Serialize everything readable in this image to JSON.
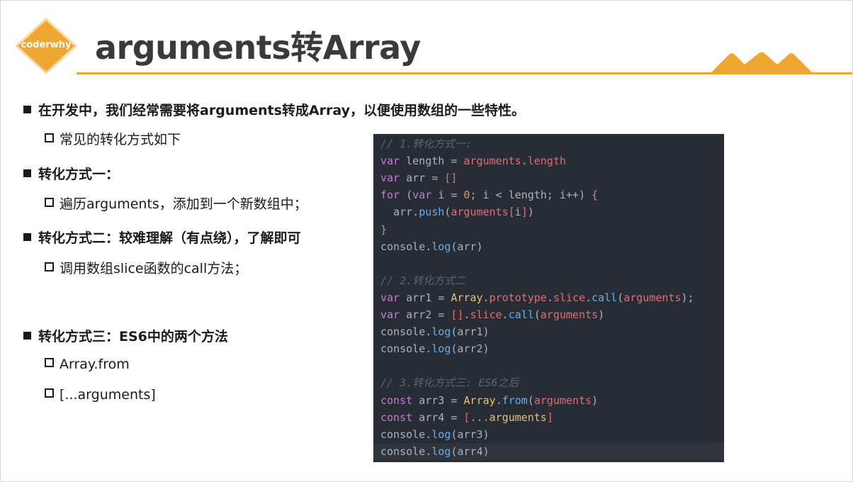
{
  "header": {
    "logo_text": "coderwhy",
    "title": "arguments转Array"
  },
  "colors": {
    "accent": "#f0a732",
    "code_bg": "#282c34"
  },
  "bullets": [
    {
      "level": 1,
      "text": "在开发中，我们经常需要将arguments转成Array，以便使用数组的一些特性。"
    },
    {
      "level": 2,
      "text": "常见的转化方式如下"
    },
    {
      "level": 1,
      "text": "转化方式一："
    },
    {
      "level": 2,
      "text": "遍历arguments，添加到一个新数组中；"
    },
    {
      "level": 1,
      "text": "转化方式二：较难理解（有点绕），了解即可"
    },
    {
      "level": 2,
      "text": "调用数组slice函数的call方法；"
    },
    {
      "level": 1,
      "text": "转化方式三：ES6中的两个方法"
    },
    {
      "level": 2,
      "text": "Array.from"
    },
    {
      "level": 2,
      "text": "[...arguments]"
    }
  ],
  "code": [
    {
      "tokens": [
        [
          "com",
          "// 1.转化方式一:"
        ]
      ]
    },
    {
      "tokens": [
        [
          "kw",
          "var"
        ],
        [
          "pl",
          " length = "
        ],
        [
          "var",
          "arguments"
        ],
        [
          "pl",
          "."
        ],
        [
          "var",
          "length"
        ]
      ]
    },
    {
      "tokens": [
        [
          "kw",
          "var"
        ],
        [
          "pl",
          " arr = "
        ],
        [
          "br",
          "[]"
        ]
      ]
    },
    {
      "tokens": [
        [
          "kw",
          "for"
        ],
        [
          "pl",
          " ("
        ],
        [
          "kw",
          "var"
        ],
        [
          "pl",
          " i = "
        ],
        [
          "num",
          "0"
        ],
        [
          "pl",
          "; i < length; i++) "
        ],
        [
          "kw",
          "{"
        ]
      ]
    },
    {
      "tokens": [
        [
          "pl",
          "  arr."
        ],
        [
          "fn",
          "push"
        ],
        [
          "pl",
          "("
        ],
        [
          "var",
          "arguments"
        ],
        [
          "br",
          "["
        ],
        [
          "pl",
          "i"
        ],
        [
          "br",
          "]"
        ],
        [
          "pl",
          ")"
        ]
      ]
    },
    {
      "tokens": [
        [
          "kw",
          "}"
        ]
      ]
    },
    {
      "tokens": [
        [
          "pl",
          "console."
        ],
        [
          "fn",
          "log"
        ],
        [
          "pl",
          "(arr)"
        ]
      ]
    },
    {
      "tokens": []
    },
    {
      "tokens": [
        [
          "com",
          "// 2.转化方式二"
        ]
      ]
    },
    {
      "tokens": [
        [
          "kw",
          "var"
        ],
        [
          "pl",
          " arr1 = "
        ],
        [
          "cls",
          "Array"
        ],
        [
          "pl",
          "."
        ],
        [
          "var",
          "prototype"
        ],
        [
          "pl",
          "."
        ],
        [
          "var",
          "slice"
        ],
        [
          "pl",
          "."
        ],
        [
          "fn",
          "call"
        ],
        [
          "pl",
          "("
        ],
        [
          "var",
          "arguments"
        ],
        [
          "pl",
          ");"
        ]
      ]
    },
    {
      "tokens": [
        [
          "kw",
          "var"
        ],
        [
          "pl",
          " arr2 = "
        ],
        [
          "br",
          "[]"
        ],
        [
          "pl",
          "."
        ],
        [
          "var",
          "slice"
        ],
        [
          "pl",
          "."
        ],
        [
          "fn",
          "call"
        ],
        [
          "pl",
          "("
        ],
        [
          "var",
          "arguments"
        ],
        [
          "pl",
          ")"
        ]
      ]
    },
    {
      "tokens": [
        [
          "pl",
          "console."
        ],
        [
          "fn",
          "log"
        ],
        [
          "pl",
          "(arr1)"
        ]
      ]
    },
    {
      "tokens": [
        [
          "pl",
          "console."
        ],
        [
          "fn",
          "log"
        ],
        [
          "pl",
          "(arr2)"
        ]
      ]
    },
    {
      "tokens": []
    },
    {
      "tokens": [
        [
          "com",
          "// 3.转化方式三: ES6之后"
        ]
      ]
    },
    {
      "tokens": [
        [
          "kw",
          "const"
        ],
        [
          "pl",
          " arr3 = "
        ],
        [
          "cls",
          "Array"
        ],
        [
          "pl",
          "."
        ],
        [
          "fn",
          "from"
        ],
        [
          "pl",
          "("
        ],
        [
          "var",
          "arguments"
        ],
        [
          "pl",
          ")"
        ]
      ]
    },
    {
      "tokens": [
        [
          "kw",
          "const"
        ],
        [
          "pl",
          " arr4 = "
        ],
        [
          "br",
          "["
        ],
        [
          "pl",
          "..."
        ],
        [
          "cls",
          "arguments"
        ],
        [
          "br",
          "]"
        ]
      ]
    },
    {
      "tokens": [
        [
          "pl",
          "console."
        ],
        [
          "fn",
          "log"
        ],
        [
          "pl",
          "(arr3)"
        ]
      ]
    },
    {
      "tokens": [
        [
          "pl",
          "console."
        ],
        [
          "fn",
          "log"
        ],
        [
          "pl",
          "(arr4)"
        ]
      ],
      "active": true
    }
  ]
}
